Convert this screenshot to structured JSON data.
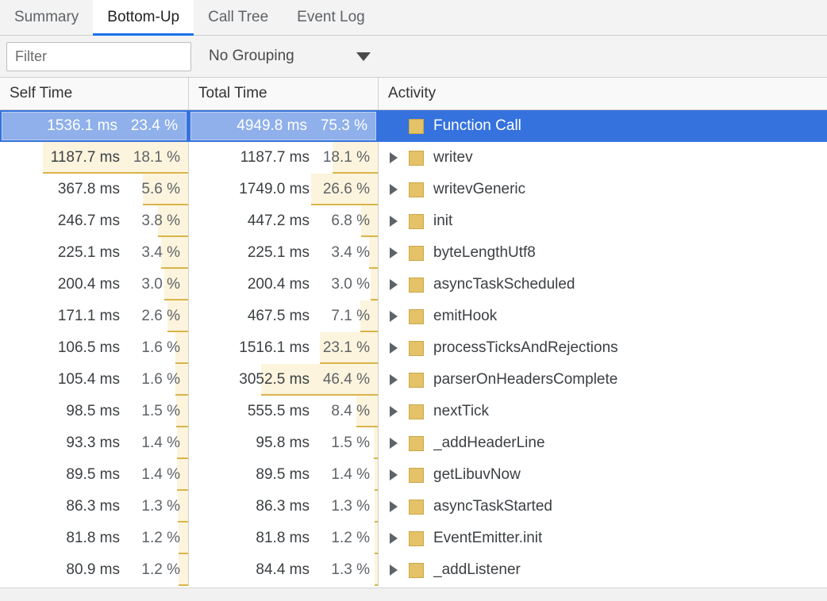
{
  "tabs": [
    {
      "label": "Summary",
      "active": false
    },
    {
      "label": "Bottom-Up",
      "active": true
    },
    {
      "label": "Call Tree",
      "active": false
    },
    {
      "label": "Event Log",
      "active": false
    }
  ],
  "toolbar": {
    "filter_placeholder": "Filter",
    "filter_value": "",
    "grouping_label": "No Grouping",
    "grouping_arrow_icon": "chevron-down-icon"
  },
  "columns": {
    "self_time": "Self Time",
    "total_time": "Total Time",
    "activity": "Activity"
  },
  "colors": {
    "selection_blue": "#3572de",
    "selection_fill": "#8fb0ea",
    "tab_underline": "#1a73e8",
    "bar_fill": "#fcf4dd",
    "bar_rule": "#d9b44a",
    "swatch_fill": "#e5c267",
    "swatch_border": "#c8a84b"
  },
  "units": {
    "ms": "ms",
    "percent": "%"
  },
  "scale": {
    "self_max_pct": 23.4,
    "total_max_pct": 75.3
  },
  "rows": [
    {
      "self_ms": "1536.1 ms",
      "self_pct": "23.4 %",
      "self_pct_val": 23.4,
      "total_ms": "4949.8 ms",
      "total_pct": "75.3 %",
      "total_pct_val": 75.3,
      "activity": "Function Call",
      "selected": true,
      "expandable": false
    },
    {
      "self_ms": "1187.7 ms",
      "self_pct": "18.1 %",
      "self_pct_val": 18.1,
      "total_ms": "1187.7 ms",
      "total_pct": "18.1 %",
      "total_pct_val": 18.1,
      "activity": "writev",
      "selected": false,
      "expandable": true
    },
    {
      "self_ms": "367.8 ms",
      "self_pct": "5.6 %",
      "self_pct_val": 5.6,
      "total_ms": "1749.0 ms",
      "total_pct": "26.6 %",
      "total_pct_val": 26.6,
      "activity": "writevGeneric",
      "selected": false,
      "expandable": true
    },
    {
      "self_ms": "246.7 ms",
      "self_pct": "3.8 %",
      "self_pct_val": 3.8,
      "total_ms": "447.2 ms",
      "total_pct": "6.8 %",
      "total_pct_val": 6.8,
      "activity": "init",
      "selected": false,
      "expandable": true
    },
    {
      "self_ms": "225.1 ms",
      "self_pct": "3.4 %",
      "self_pct_val": 3.4,
      "total_ms": "225.1 ms",
      "total_pct": "3.4 %",
      "total_pct_val": 3.4,
      "activity": "byteLengthUtf8",
      "selected": false,
      "expandable": true
    },
    {
      "self_ms": "200.4 ms",
      "self_pct": "3.0 %",
      "self_pct_val": 3.0,
      "total_ms": "200.4 ms",
      "total_pct": "3.0 %",
      "total_pct_val": 3.0,
      "activity": "asyncTaskScheduled",
      "selected": false,
      "expandable": true
    },
    {
      "self_ms": "171.1 ms",
      "self_pct": "2.6 %",
      "self_pct_val": 2.6,
      "total_ms": "467.5 ms",
      "total_pct": "7.1 %",
      "total_pct_val": 7.1,
      "activity": "emitHook",
      "selected": false,
      "expandable": true
    },
    {
      "self_ms": "106.5 ms",
      "self_pct": "1.6 %",
      "self_pct_val": 1.6,
      "total_ms": "1516.1 ms",
      "total_pct": "23.1 %",
      "total_pct_val": 23.1,
      "activity": "processTicksAndRejections",
      "selected": false,
      "expandable": true
    },
    {
      "self_ms": "105.4 ms",
      "self_pct": "1.6 %",
      "self_pct_val": 1.6,
      "total_ms": "3052.5 ms",
      "total_pct": "46.4 %",
      "total_pct_val": 46.4,
      "activity": "parserOnHeadersComplete",
      "selected": false,
      "expandable": true
    },
    {
      "self_ms": "98.5 ms",
      "self_pct": "1.5 %",
      "self_pct_val": 1.5,
      "total_ms": "555.5 ms",
      "total_pct": "8.4 %",
      "total_pct_val": 8.4,
      "activity": "nextTick",
      "selected": false,
      "expandable": true
    },
    {
      "self_ms": "93.3 ms",
      "self_pct": "1.4 %",
      "self_pct_val": 1.4,
      "total_ms": "95.8 ms",
      "total_pct": "1.5 %",
      "total_pct_val": 1.5,
      "activity": "_addHeaderLine",
      "selected": false,
      "expandable": true
    },
    {
      "self_ms": "89.5 ms",
      "self_pct": "1.4 %",
      "self_pct_val": 1.4,
      "total_ms": "89.5 ms",
      "total_pct": "1.4 %",
      "total_pct_val": 1.4,
      "activity": "getLibuvNow",
      "selected": false,
      "expandable": true
    },
    {
      "self_ms": "86.3 ms",
      "self_pct": "1.3 %",
      "self_pct_val": 1.3,
      "total_ms": "86.3 ms",
      "total_pct": "1.3 %",
      "total_pct_val": 1.3,
      "activity": "asyncTaskStarted",
      "selected": false,
      "expandable": true
    },
    {
      "self_ms": "81.8 ms",
      "self_pct": "1.2 %",
      "self_pct_val": 1.2,
      "total_ms": "81.8 ms",
      "total_pct": "1.2 %",
      "total_pct_val": 1.2,
      "activity": "EventEmitter.init",
      "selected": false,
      "expandable": true
    },
    {
      "self_ms": "80.9 ms",
      "self_pct": "1.2 %",
      "self_pct_val": 1.2,
      "total_ms": "84.4 ms",
      "total_pct": "1.3 %",
      "total_pct_val": 1.3,
      "activity": "_addListener",
      "selected": false,
      "expandable": true
    }
  ]
}
